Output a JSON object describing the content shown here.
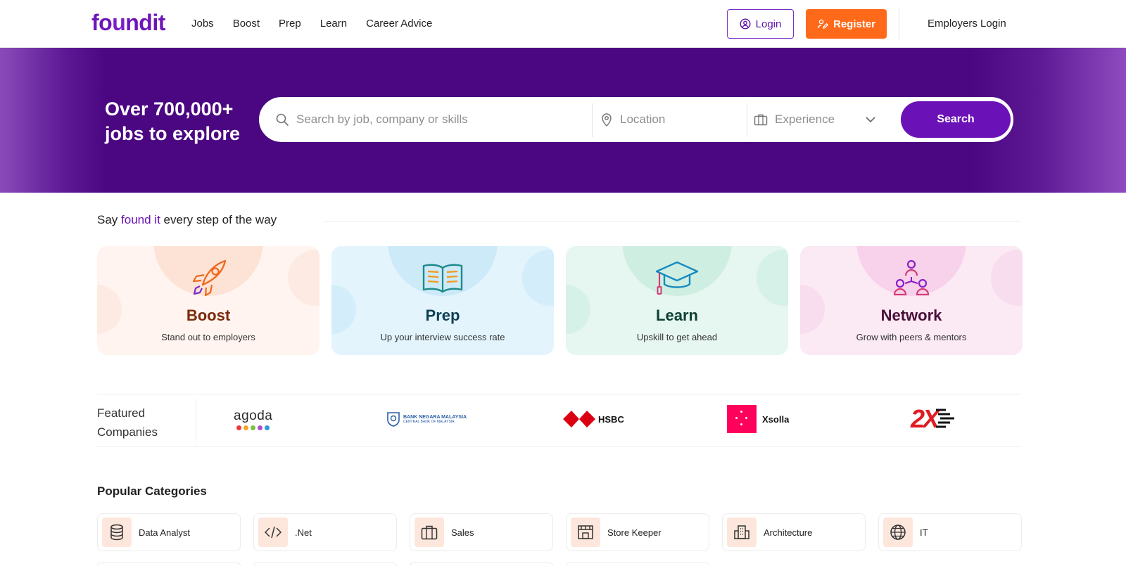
{
  "header": {
    "logo_pre": "fo",
    "logo_u": "u",
    "logo_post": "ndit",
    "nav": [
      "Jobs",
      "Boost",
      "Prep",
      "Learn",
      "Career Advice"
    ],
    "login_label": "Login",
    "register_label": "Register",
    "employers_login": "Employers Login"
  },
  "hero": {
    "title_line1": "Over 700,000+",
    "title_line2": "jobs to explore",
    "search_placeholder": "Search by job, company or skills",
    "location_placeholder": "Location",
    "experience_placeholder": "Experience",
    "search_button": "Search"
  },
  "found_it": {
    "tagline_pre": "Say ",
    "tagline_accent": "found it",
    "tagline_post": " every step of the way",
    "cards": [
      {
        "title": "Boost",
        "subtitle": "Stand out to employers",
        "icon": "rocket-icon"
      },
      {
        "title": "Prep",
        "subtitle": "Up your interview success rate",
        "icon": "open-book-icon"
      },
      {
        "title": "Learn",
        "subtitle": "Upskill to get ahead",
        "icon": "graduation-cap-icon"
      },
      {
        "title": "Network",
        "subtitle": "Grow with peers & mentors",
        "icon": "people-network-icon"
      }
    ]
  },
  "featured": {
    "label_line1": "Featured",
    "label_line2": "Companies",
    "companies": [
      {
        "name": "agoda"
      },
      {
        "name": "BANK NEGARA MALAYSIA",
        "subtitle": "CENTRAL BANK OF MALAYSIA"
      },
      {
        "name": "HSBC"
      },
      {
        "name": "Xsolla"
      },
      {
        "name": "2X"
      }
    ]
  },
  "categories": {
    "title": "Popular Categories",
    "items": [
      {
        "label": "Data Analyst",
        "icon": "database-icon"
      },
      {
        "label": ".Net",
        "icon": "code-icon"
      },
      {
        "label": "Sales",
        "icon": "briefcase-icon"
      },
      {
        "label": "Store Keeper",
        "icon": "storefront-icon"
      },
      {
        "label": "Architecture",
        "icon": "building-icon"
      },
      {
        "label": "IT",
        "icon": "globe-icon"
      }
    ]
  },
  "colors": {
    "brand_purple": "#6a11b7",
    "hero_purple": "#4b0782",
    "register_orange": "#ff6a1a"
  }
}
